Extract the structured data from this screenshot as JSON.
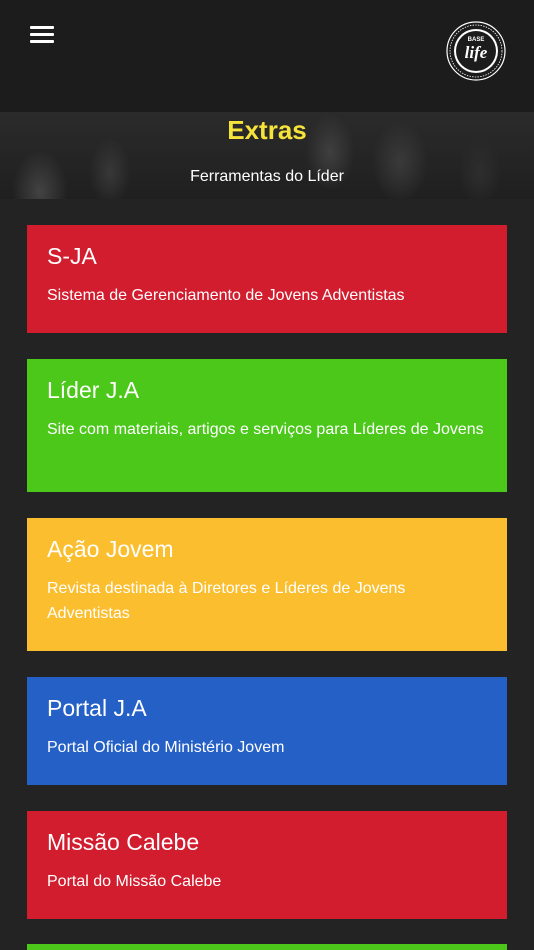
{
  "header": {
    "menu_icon": "hamburger-menu-icon",
    "logo": {
      "icon": "base-life-logo-icon",
      "top_text": "BASE",
      "main_text": "life"
    }
  },
  "hero": {
    "title": "Extras",
    "subtitle": "Ferramentas do Líder",
    "title_color": "#f6e33a"
  },
  "cards": [
    {
      "title": "S-JA",
      "description": "Sistema de Gerenciamento de Jovens Adventistas",
      "color": "#d21d2f"
    },
    {
      "title": "Líder J.A",
      "description": "Site com materiais, artigos e serviços para Líderes de Jovens",
      "color": "#4bc81a"
    },
    {
      "title": "Ação Jovem",
      "description": "Revista destinada à Diretores e Líderes de Jovens Adventistas",
      "color": "#fbbe2f"
    },
    {
      "title": "Portal J.A",
      "description": "Portal Oficial do Ministério Jovem",
      "color": "#2560c6"
    },
    {
      "title": "Missão Calebe",
      "description": "Portal do Missão Calebe",
      "color": "#d21d2f"
    }
  ],
  "partial_card_color": "#4bc81a"
}
